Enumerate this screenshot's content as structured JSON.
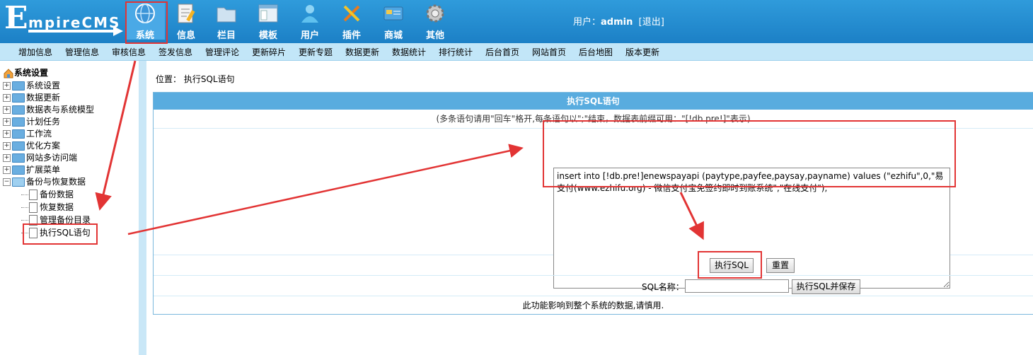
{
  "logo": {
    "initial": "E",
    "rest": "mpireCMS"
  },
  "nav": [
    {
      "label": "系统",
      "icon": "globe-icon"
    },
    {
      "label": "信息",
      "icon": "document-edit-icon"
    },
    {
      "label": "栏目",
      "icon": "folder-icon"
    },
    {
      "label": "模板",
      "icon": "window-template-icon"
    },
    {
      "label": "用户",
      "icon": "user-icon"
    },
    {
      "label": "插件",
      "icon": "tools-icon"
    },
    {
      "label": "商城",
      "icon": "card-icon"
    },
    {
      "label": "其他",
      "icon": "gear-icon"
    }
  ],
  "user": {
    "prefix": "用户：",
    "name": "admin",
    "logout": "[退出]"
  },
  "submenu": [
    "增加信息",
    "管理信息",
    "审核信息",
    "签发信息",
    "管理评论",
    "更新碎片",
    "更新专题",
    "数据更新",
    "数据统计",
    "排行统计",
    "后台首页",
    "网站首页",
    "后台地图",
    "版本更新"
  ],
  "sidebar": {
    "root": "系统设置",
    "folders": [
      "系统设置",
      "数据更新",
      "数据表与系统模型",
      "计划任务",
      "工作流",
      "优化方案",
      "网站多访问端",
      "扩展菜单"
    ],
    "open_folder": "备份与恢复数据",
    "children": [
      "备份数据",
      "恢复数据",
      "管理备份目录",
      "执行SQL语句"
    ]
  },
  "location": {
    "label": "位置：",
    "value": "执行SQL语句"
  },
  "panel": {
    "title": "执行SQL语句",
    "hint": "(多条语句请用\"回车\"格开,每条语句以\";\"结束，数据表前缀可用：\"[!db.pre!]\"表示)",
    "sql": "insert into [!db.pre!]enewspayapi (paytype,payfee,paysay,payname) values (\"ezhifu\",0,\"易支付(www.ezhifu.org) - 微信支付宝免签约即时到账系统\",\"在线支付\");",
    "execute_button": "执行SQL",
    "reset_button": "重置",
    "name_label": "SQL名称：",
    "save_button": "执行SQL并保存",
    "warning": "此功能影响到整个系统的数据,请慎用."
  },
  "colors": {
    "header": "#1c80c6",
    "submenu": "#c2e6f8",
    "panel_head": "#59acdf",
    "annotation": "#e23434"
  }
}
